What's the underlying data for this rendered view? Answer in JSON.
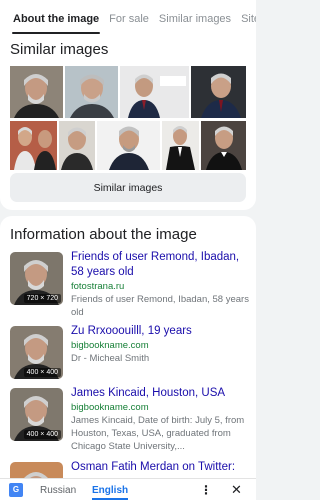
{
  "tabs": [
    {
      "label": "About the image"
    },
    {
      "label": "For sale"
    },
    {
      "label": "Similar images"
    },
    {
      "label": "Sites"
    }
  ],
  "similar": {
    "title": "Similar images",
    "button_label": "Similar images"
  },
  "info": {
    "title": "Information about the image",
    "results": [
      {
        "title": "Friends of user Remond, Ibadan, 58 years old",
        "domain": "fotostrana.ru",
        "desc": "Friends of user Remond, Ibadan, 58 years old",
        "dims": "720 × 720"
      },
      {
        "title": "Zu Rrxooouilll, 19 years",
        "domain": "bigbookname.com",
        "desc": "Dr - Micheal Smith",
        "dims": "400 × 400"
      },
      {
        "title": "James Kincaid, Houston, USA",
        "domain": "bigbookname.com",
        "desc": "James Kincaid, Date of birth: July 5, from Houston, Texas, USA, graduated from Chicago State University,...",
        "dims": "400 × 400"
      },
      {
        "title": "Osman Fatih Merdan on Twitter:",
        "domain": "",
        "desc": "",
        "dims": ""
      }
    ]
  },
  "translate": {
    "source": "Russian",
    "target": "English"
  },
  "colors": {
    "link": "#1a0dab",
    "domain": "#188038",
    "accent": "#1a73e8"
  }
}
